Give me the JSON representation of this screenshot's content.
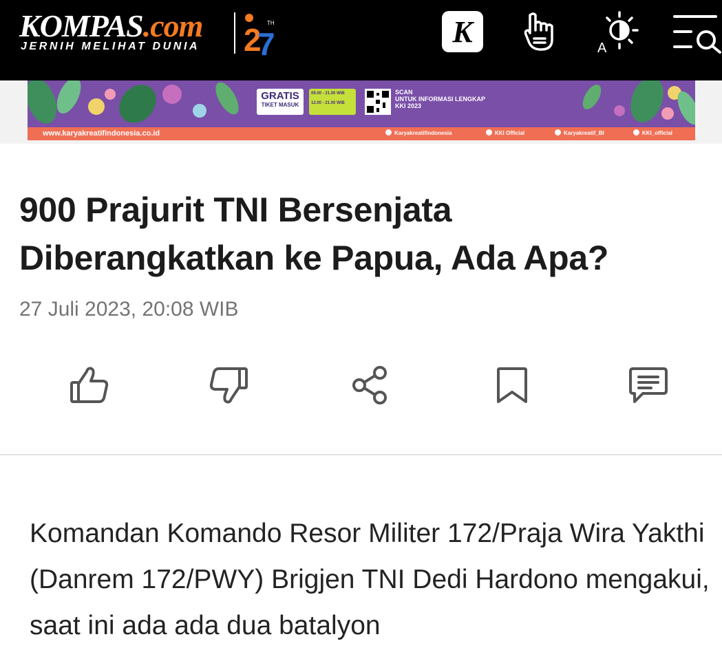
{
  "header": {
    "logo_main": "KOMPAS",
    "logo_suffix": ".com",
    "logo_tagline": "JERNIH MELIHAT DUNIA",
    "logo_anniversary": "27",
    "k_button_label": "K",
    "theme_button_label": "A",
    "colors": {
      "background": "#000000",
      "brand_orange": "#f47b20"
    }
  },
  "banner": {
    "gratis": "GRATIS",
    "gratis_sub": "TIKET MASUK",
    "hours_1": "09.00 - 21.00 WIB",
    "hours_2": "12.00 - 21.00 WIB",
    "scan": "SCAN",
    "scan_info": "UNTUK INFORMASI LENGKAP",
    "scan_event": "KKI 2023",
    "site": "www.karyakreatifindonesia.co.id",
    "socials": [
      "Karyakreatifindonesia",
      "KKI Official",
      "Karyakreatif_BI",
      "KKI_official"
    ],
    "colors": {
      "background": "#7a4fa8",
      "footer": "#ef6e54"
    }
  },
  "article": {
    "title": "900 Prajurit TNI Bersenjata Diberangkatkan ke Papua, Ada Apa?",
    "timestamp": "27 Juli 2023, 20:08 WIB",
    "body": "Komandan Komando Resor Militer 172/Praja Wira Yakthi (Danrem 172/PWY) Brigjen TNI Dedi Hardono mengakui, saat ini ada ada dua batalyon"
  },
  "actions": [
    {
      "icon": "thumbs-up-icon"
    },
    {
      "icon": "thumbs-down-icon"
    },
    {
      "icon": "share-icon"
    },
    {
      "icon": "bookmark-icon"
    },
    {
      "icon": "comment-icon"
    }
  ]
}
